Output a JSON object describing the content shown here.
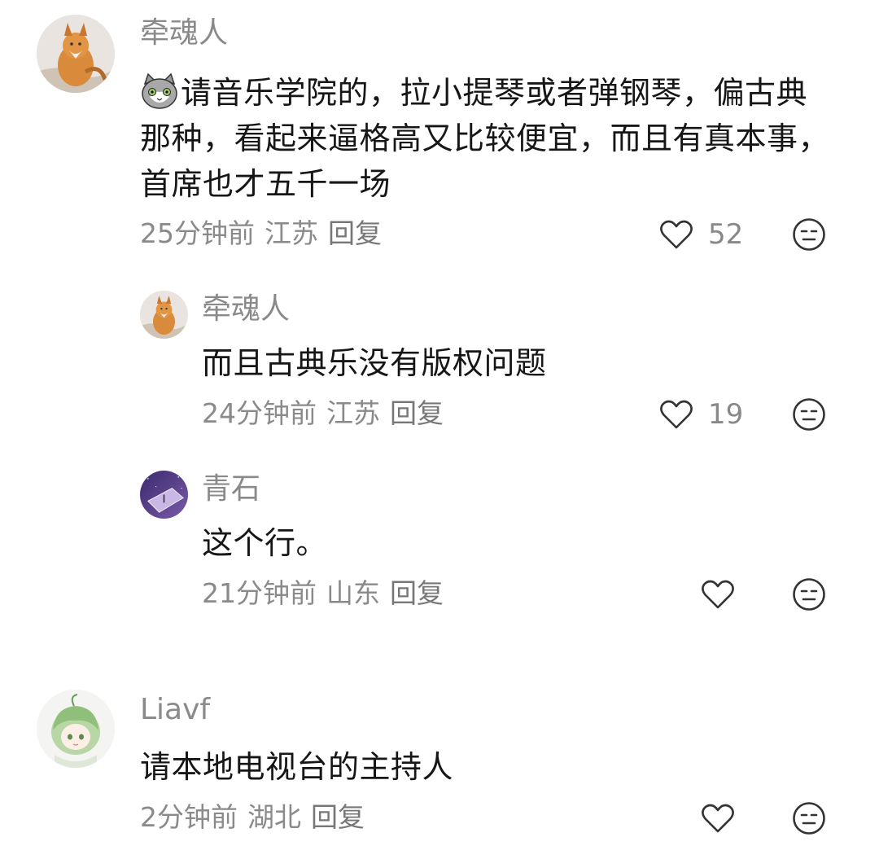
{
  "comments": [
    {
      "username": "牵魂人",
      "emoji": "cat-emoji",
      "text": "请音乐学院的，拉小提琴或者弹钢琴，偏古典那种，看起来逼格高又比较便宜，而且有真本事，首席也才五千一场",
      "time": "25分钟前",
      "location": "江苏",
      "reply": "回复",
      "likes": "52"
    },
    {
      "username": "牵魂人",
      "text": "而且古典乐没有版权问题",
      "time": "24分钟前",
      "location": "江苏",
      "reply": "回复",
      "likes": "19"
    },
    {
      "username": "青石",
      "text": "这个行。",
      "time": "21分钟前",
      "location": "山东",
      "reply": "回复",
      "likes": ""
    },
    {
      "username": "Liavf",
      "text": "请本地电视台的主持人",
      "time": "2分钟前",
      "location": "湖北",
      "reply": "回复",
      "likes": ""
    }
  ],
  "icons": {
    "like": "heart-outline-icon",
    "dislike": "meh-face-icon"
  },
  "colors": {
    "text_primary": "#161616",
    "text_secondary": "#8a8a8a",
    "icon": "#333333"
  }
}
